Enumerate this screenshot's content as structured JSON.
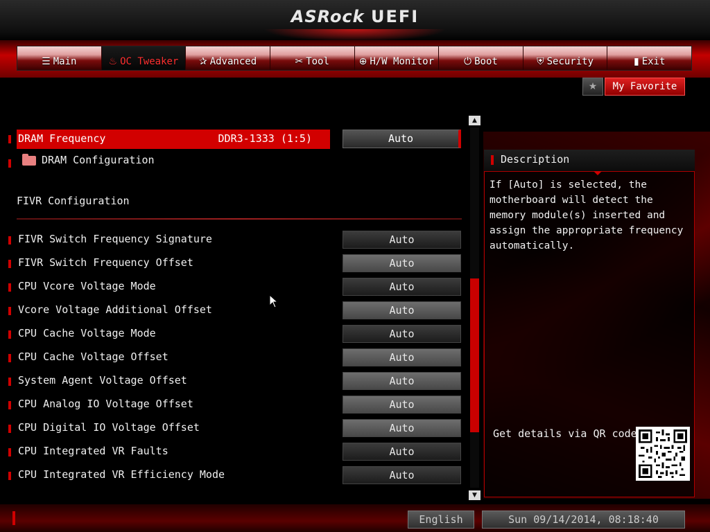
{
  "header": {
    "logo_brand": "ASRock",
    "logo_product": "UEFI"
  },
  "tabs": [
    {
      "icon": "☰",
      "label": "Main"
    },
    {
      "icon": "♨",
      "label": "OC Tweaker",
      "active": true
    },
    {
      "icon": "✰",
      "label": "Advanced"
    },
    {
      "icon": "✂",
      "label": "Tool"
    },
    {
      "icon": "⊕",
      "label": "H/W Monitor"
    },
    {
      "icon": "⏻",
      "label": "Boot"
    },
    {
      "icon": "⛨",
      "label": "Security"
    },
    {
      "icon": "▮",
      "label": "Exit"
    }
  ],
  "favorite": {
    "star": "★",
    "label": "My Favorite"
  },
  "settings": {
    "dram_frequency": {
      "label": "DRAM Frequency",
      "value": "DDR3-1333 (1:5)",
      "option": "Auto"
    },
    "dram_configuration": "DRAM Configuration",
    "fivr_heading": "FIVR Configuration",
    "items": [
      {
        "label": "FIVR Switch Frequency Signature",
        "value": "Auto",
        "style": "dark"
      },
      {
        "label": "FIVR Switch Frequency Offset",
        "value": "Auto",
        "style": "light"
      },
      {
        "label": "CPU Vcore Voltage Mode",
        "value": "Auto",
        "style": "dark"
      },
      {
        "label": "Vcore Voltage Additional Offset",
        "value": "Auto",
        "style": "light"
      },
      {
        "label": "CPU Cache Voltage Mode",
        "value": "Auto",
        "style": "dark"
      },
      {
        "label": "CPU Cache Voltage Offset",
        "value": "Auto",
        "style": "light"
      },
      {
        "label": "System Agent Voltage Offset",
        "value": "Auto",
        "style": "light"
      },
      {
        "label": "CPU Analog IO Voltage Offset",
        "value": "Auto",
        "style": "light"
      },
      {
        "label": "CPU Digital IO Voltage Offset",
        "value": "Auto",
        "style": "light"
      },
      {
        "label": "CPU Integrated VR Faults",
        "value": "Auto",
        "style": "dark"
      },
      {
        "label": "CPU Integrated VR Efficiency Mode",
        "value": "Auto",
        "style": "dark"
      }
    ]
  },
  "scrollbar": {
    "up": "▲",
    "down": "▼"
  },
  "description": {
    "title": "Description",
    "text": "If [Auto] is selected, the motherboard will detect the memory module(s) inserted and assign the appropriate frequency automatically.",
    "qr_label": "Get details via QR code"
  },
  "footer": {
    "language": "English",
    "datetime": "Sun 09/14/2014, 08:18:40"
  },
  "colors": {
    "accent": "#d20000",
    "background": "#000000"
  }
}
